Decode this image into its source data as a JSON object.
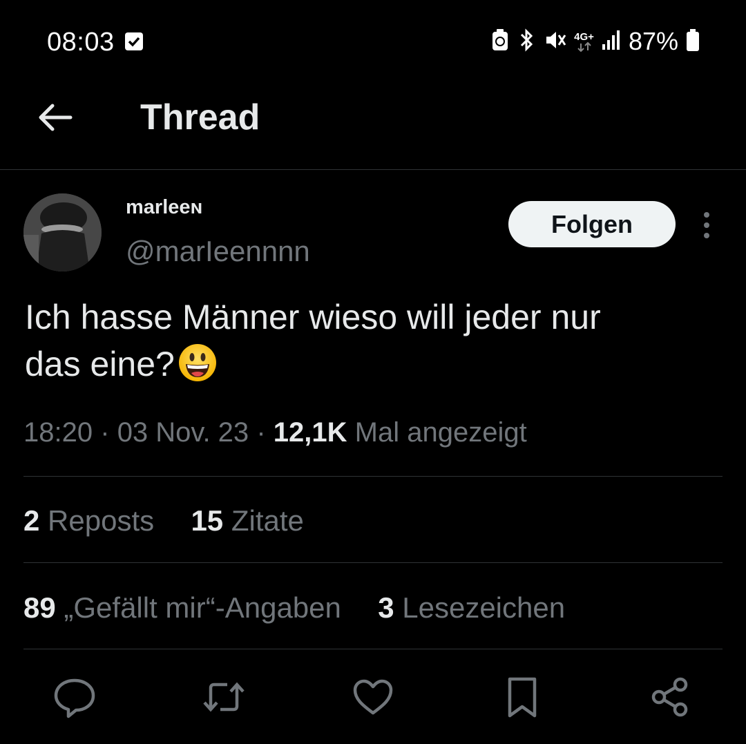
{
  "status_bar": {
    "time": "08:03",
    "battery_percent": "87%",
    "network_label": "4G+",
    "icons": [
      "notification-check-icon",
      "battery-saver-icon",
      "bluetooth-icon",
      "mute-icon",
      "network-4g-icon",
      "signal-icon",
      "battery-icon"
    ]
  },
  "header": {
    "back_icon": "arrow-left-icon",
    "title": "Thread"
  },
  "tweet": {
    "display_name": "marleeɴ",
    "handle": "@marIeennnn",
    "follow_label": "Folgen",
    "text_line1": "Ich hasse Männer wieso will jeder nur",
    "text_line2": "das eine?",
    "emoji": "grinning-face-emoji",
    "time": "18:20",
    "date": "03 Nov. 23",
    "views_count": "12,1K",
    "views_label": "Mal angezeigt",
    "sep": "·"
  },
  "stats": {
    "reposts_count": "2",
    "reposts_label": "Reposts",
    "quotes_count": "15",
    "quotes_label": "Zitate",
    "likes_count": "89",
    "likes_label": "„Gefällt mir“-Angaben",
    "bookmarks_count": "3",
    "bookmarks_label": "Lesezeichen"
  },
  "actions": [
    "reply-icon",
    "repost-icon",
    "like-icon",
    "bookmark-icon",
    "share-icon"
  ],
  "colors": {
    "background": "#000000",
    "text": "#e7e9ea",
    "muted": "#71767b",
    "divider": "#2f3336",
    "button": "#eff3f4"
  }
}
